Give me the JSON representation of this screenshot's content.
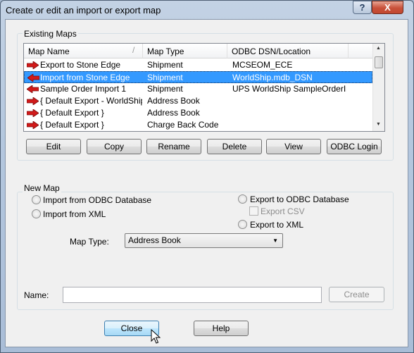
{
  "window": {
    "title": "Create or edit an import or export map",
    "help_glyph": "?",
    "close_glyph": "X"
  },
  "existing_maps": {
    "group_label": "Existing Maps",
    "columns": [
      "Map Name",
      "Map Type",
      "ODBC DSN/Location"
    ],
    "rows": [
      {
        "name": "Export to Stone Edge",
        "type": "Shipment",
        "location": "MCSEOM_ECE",
        "direction": "export",
        "selected": false
      },
      {
        "name": "Import from Stone Edge",
        "type": "Shipment",
        "location": "WorldShip.mdb_DSN",
        "direction": "import",
        "selected": true
      },
      {
        "name": "Sample Order Import 1",
        "type": "Shipment",
        "location": "UPS WorldShip SampleOrderIm...",
        "direction": "import",
        "selected": false
      },
      {
        "name": "{ Default Export - WorldShip }",
        "type": "Address Book",
        "location": "",
        "direction": "export",
        "selected": false
      },
      {
        "name": "{ Default Export }",
        "type": "Address Book",
        "location": "",
        "direction": "export",
        "selected": false
      },
      {
        "name": "{ Default Export }",
        "type": "Charge Back Code",
        "location": "",
        "direction": "export",
        "selected": false
      }
    ],
    "buttons": {
      "edit": "Edit",
      "copy": "Copy",
      "rename": "Rename",
      "delete": "Delete",
      "view": "View",
      "odbc_login": "ODBC Login"
    }
  },
  "new_map": {
    "group_label": "New Map",
    "import_odbc": "Import from ODBC Database",
    "import_xml": "Import from XML",
    "export_odbc": "Export to ODBC Database",
    "export_csv": "Export CSV",
    "export_xml": "Export to XML",
    "map_type_label": "Map Type:",
    "map_type_value": "Address Book",
    "name_label": "Name:",
    "name_value": "",
    "create_button": "Create"
  },
  "footer": {
    "close_button": "Close",
    "help_button": "Help"
  },
  "colors": {
    "selection": "#3399ff",
    "arrow_red": "#d11a1a",
    "client_bg": "#f0f0f0"
  }
}
